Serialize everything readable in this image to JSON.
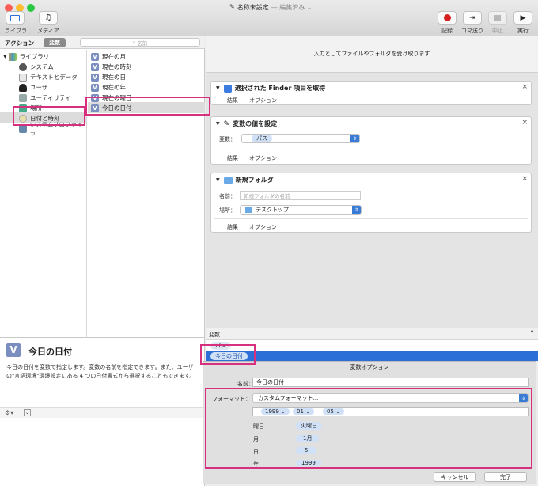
{
  "window": {
    "title": "名称未設定",
    "subtitle": "— 編集済み ⌄"
  },
  "toolbar": {
    "library": "ライブラリ",
    "media": "メディア",
    "record": "記録",
    "step": "コマ送り",
    "stop": "中止",
    "run": "実行"
  },
  "left": {
    "tab_actions": "アクション",
    "tab_variables": "変数",
    "search_placeholder": "名前",
    "library": "ライブラリ",
    "categories": [
      "システム",
      "テキストとデータ",
      "ユーザ",
      "ユーティリティ",
      "場所",
      "日付と時刻",
      "システムプロファイラ"
    ],
    "variables": [
      "現在の月",
      "現在の時刻",
      "現在の日",
      "現在の年",
      "現在の曜日",
      "今日の日付"
    ]
  },
  "description": {
    "title": "今日の日付",
    "body": "今日の日付を変数で指定します。変数の名前を指定できます。また、ユーザの\"言語環境\"環境設定にある 4 つの日付書式から選択することもできます。"
  },
  "workflow": {
    "hint": "入力としてファイルやフォルダを受け取ります",
    "a1": {
      "title": "選択された Finder 項目を取得",
      "results": "結果",
      "options": "オプション"
    },
    "a2": {
      "title": "変数の値を設定",
      "var_label": "変数：",
      "var_value": "パス",
      "results": "結果",
      "options": "オプション"
    },
    "a3": {
      "title": "新規フォルダ",
      "name_label": "名前：",
      "name_placeholder": "新規フォルダの名前",
      "where_label": "場所：",
      "where_value": "デスクトップ",
      "results": "結果",
      "options": "オプション"
    }
  },
  "varpanel": {
    "header": "変数",
    "items": [
      "パス",
      "今日の日付"
    ]
  },
  "options": {
    "title": "変数オプション",
    "name_label": "名前：",
    "name_value": "今日の日付",
    "format_label": "フォーマット：",
    "format_value": "カスタムフォーマット...",
    "year": "1999",
    "month": "01",
    "day": "05",
    "rows": [
      {
        "label": "曜日",
        "value": "火曜日"
      },
      {
        "label": "月",
        "value": "1月"
      },
      {
        "label": "日",
        "value": "5"
      },
      {
        "label": "年",
        "value": "1999"
      }
    ],
    "cancel": "キャンセル",
    "done": "完了"
  },
  "colors": {
    "highlight": "#d6307f",
    "selection": "#2c6fd6",
    "token": "#cfe0f7"
  }
}
